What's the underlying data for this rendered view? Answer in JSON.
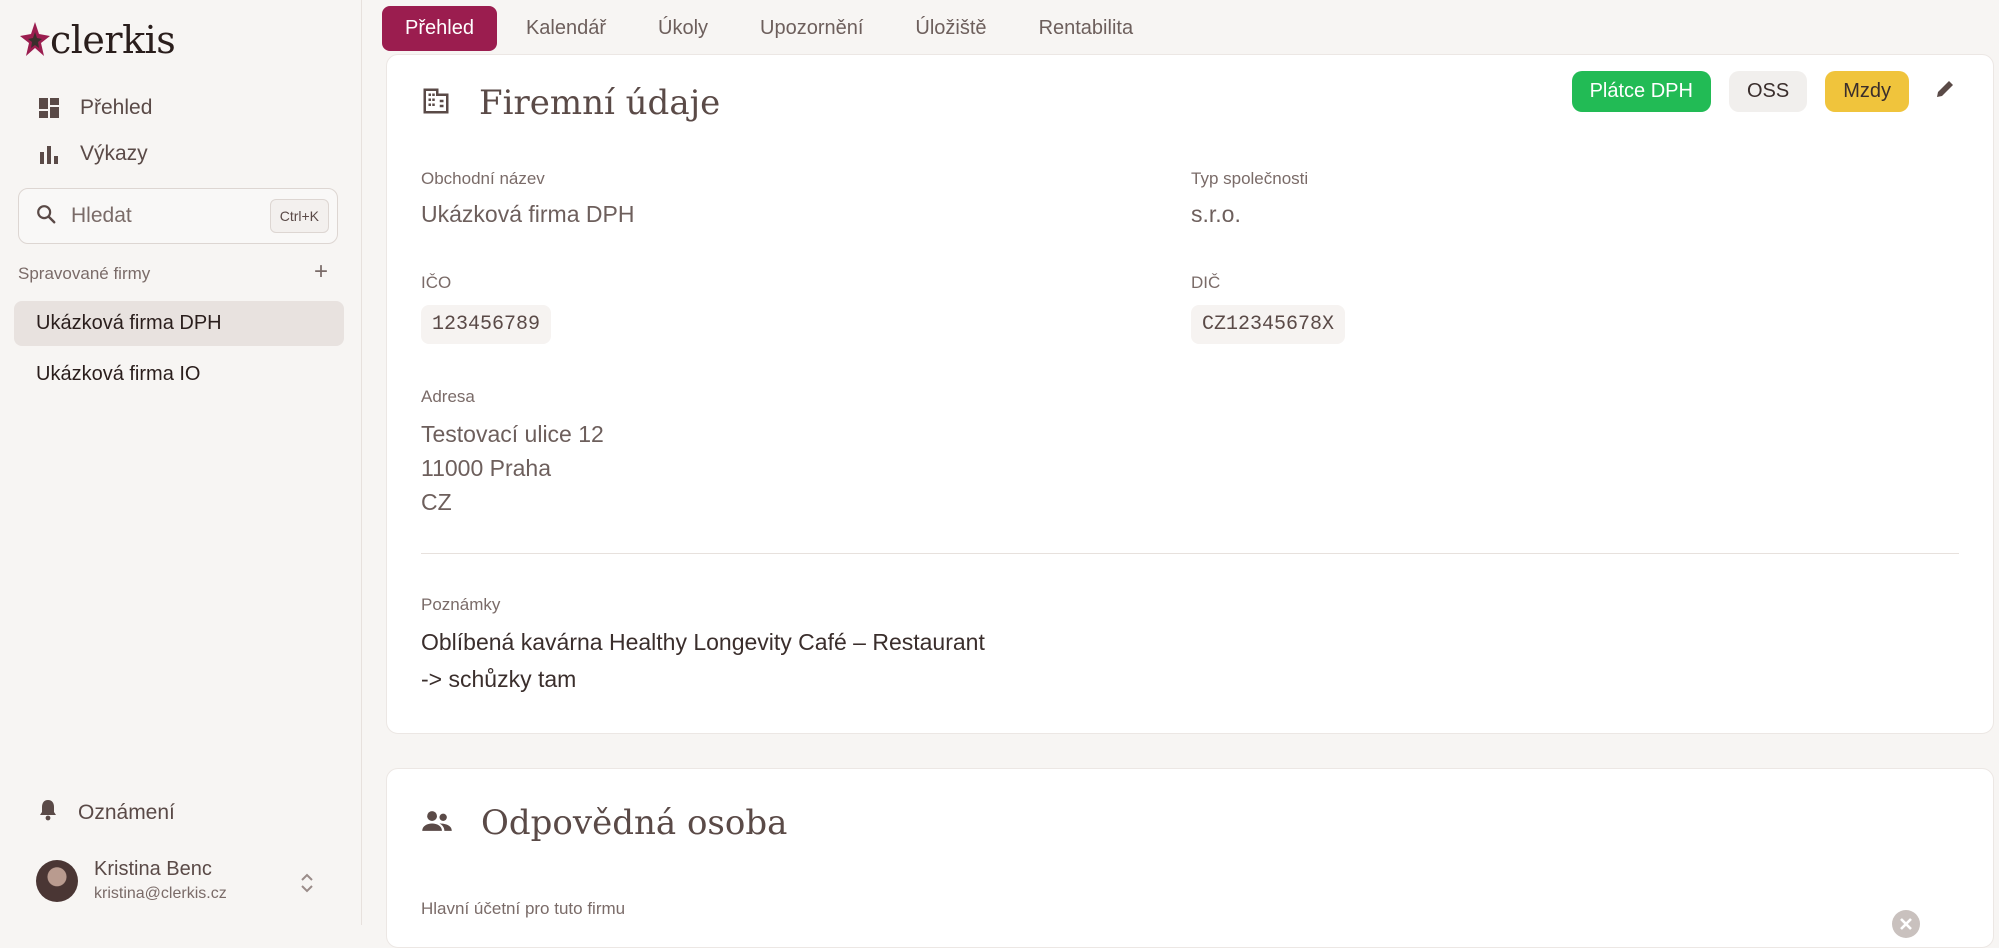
{
  "app": {
    "logo_text": "clerkis"
  },
  "sidebar": {
    "nav": [
      {
        "label": "Přehled",
        "icon": "dashboard-icon"
      },
      {
        "label": "Výkazy",
        "icon": "bar-chart-icon"
      }
    ],
    "search": {
      "placeholder": "Hledat",
      "shortcut": "Ctrl+K"
    },
    "companies_label": "Spravované firmy",
    "add_label": "+",
    "companies": [
      {
        "label": "Ukázková firma DPH",
        "active": true
      },
      {
        "label": "Ukázková firma IO",
        "active": false
      }
    ],
    "notifications_label": "Oznámení",
    "user": {
      "name": "Kristina Benc",
      "email": "kristina@clerkis.cz"
    }
  },
  "tabs": [
    {
      "label": "Přehled",
      "active": true
    },
    {
      "label": "Kalendář"
    },
    {
      "label": "Úkoly"
    },
    {
      "label": "Upozornění"
    },
    {
      "label": "Úložiště"
    },
    {
      "label": "Rentabilita"
    }
  ],
  "company_card": {
    "title": "Firemní údaje",
    "badges": [
      "Plátce DPH",
      "OSS",
      "Mzdy"
    ],
    "fields": {
      "name_label": "Obchodní název",
      "name_value": "Ukázková firma DPH",
      "type_label": "Typ společnosti",
      "type_value": "s.r.o.",
      "ico_label": "IČO",
      "ico_value": "123456789",
      "dic_label": "DIČ",
      "dic_value": "CZ12345678X",
      "address_label": "Adresa",
      "address_lines": [
        "Testovací ulice 12",
        "11000 Praha",
        "CZ"
      ],
      "notes_label": "Poznámky",
      "notes_lines": [
        "Oblíbená kavárna Healthy Longevity Café – Restaurant",
        "-> schůzky tam"
      ]
    }
  },
  "responsible_card": {
    "title": "Odpovědná osoba",
    "main_accountant_label": "Hlavní účetní pro tuto firmu"
  },
  "colors": {
    "accent": "#9b1d4f",
    "badge_green": "#22bb55",
    "badge_yellow": "#f0c43c",
    "background": "#f7f5f3"
  }
}
